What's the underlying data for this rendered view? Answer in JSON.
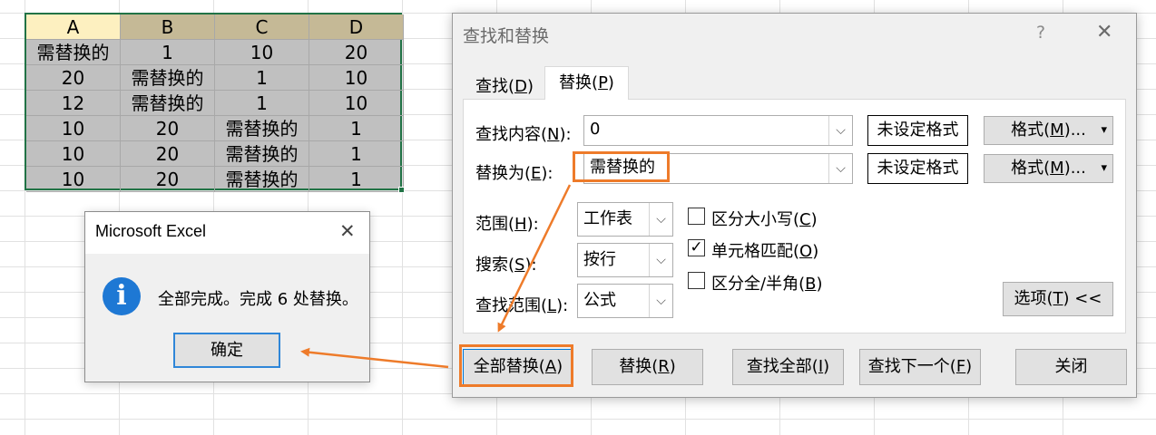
{
  "sheet": {
    "columns": [
      "A",
      "B",
      "C",
      "D"
    ],
    "rows": [
      [
        "需替换的",
        "1",
        "10",
        "20"
      ],
      [
        "20",
        "需替换的",
        "1",
        "10"
      ],
      [
        "12",
        "需替换的",
        "1",
        "10"
      ],
      [
        "10",
        "20",
        "需替换的",
        "1"
      ],
      [
        "10",
        "20",
        "需替换的",
        "1"
      ],
      [
        "10",
        "20",
        "需替换的",
        "1"
      ]
    ]
  },
  "dialog": {
    "title": "查找和替换",
    "help_glyph": "?",
    "close_glyph": "✕",
    "tabs": [
      {
        "pre": "查找(",
        "key": "D",
        "post": ")"
      },
      {
        "pre": "替换(",
        "key": "P",
        "post": ")"
      }
    ],
    "find_label": {
      "pre": "查找内容(",
      "key": "N",
      "post": "):"
    },
    "find_value": "0",
    "replace_label": {
      "pre": "替换为(",
      "key": "E",
      "post": "):"
    },
    "replace_value": "需替换的",
    "no_format": "未设定格式",
    "format_button": {
      "pre": "格式(",
      "key": "M",
      "post": ")..."
    },
    "dropdown_glyph": "⌵",
    "split_arrow": "▾",
    "within_label": {
      "pre": "范围(",
      "key": "H",
      "post": "):"
    },
    "within_value": "工作表",
    "search_label": {
      "pre": "搜索(",
      "key": "S",
      "post": "):"
    },
    "search_value": "按行",
    "lookin_label": {
      "pre": "查找范围(",
      "key": "L",
      "post": "):"
    },
    "lookin_value": "公式",
    "match_case": {
      "pre": "区分大小写(",
      "key": "C",
      "post": ")",
      "checked": false
    },
    "match_cell": {
      "pre": "单元格匹配(",
      "key": "O",
      "post": ")",
      "checked": true
    },
    "match_width": {
      "pre": "区分全/半角(",
      "key": "B",
      "post": ")",
      "checked": false
    },
    "check_glyph": "✓",
    "options_button": {
      "pre": "选项(",
      "key": "T",
      "post": ") <<"
    },
    "replace_all_button": {
      "pre": "全部替换(",
      "key": "A",
      "post": ")"
    },
    "replace_button": {
      "pre": "替换(",
      "key": "R",
      "post": ")"
    },
    "find_all_button": {
      "pre": "查找全部(",
      "key": "I",
      "post": ")"
    },
    "find_next_button": {
      "pre": "查找下一个(",
      "key": "F",
      "post": ")"
    },
    "close_button": "关闭"
  },
  "message_box": {
    "title": "Microsoft Excel",
    "close_glyph": "✕",
    "info_glyph": "i",
    "message": "全部完成。完成 6 处替换。",
    "ok_button": "确定"
  },
  "colors": {
    "highlight": "#ee7b2a",
    "selection": "#217346",
    "info_icon": "#1e78d4"
  }
}
